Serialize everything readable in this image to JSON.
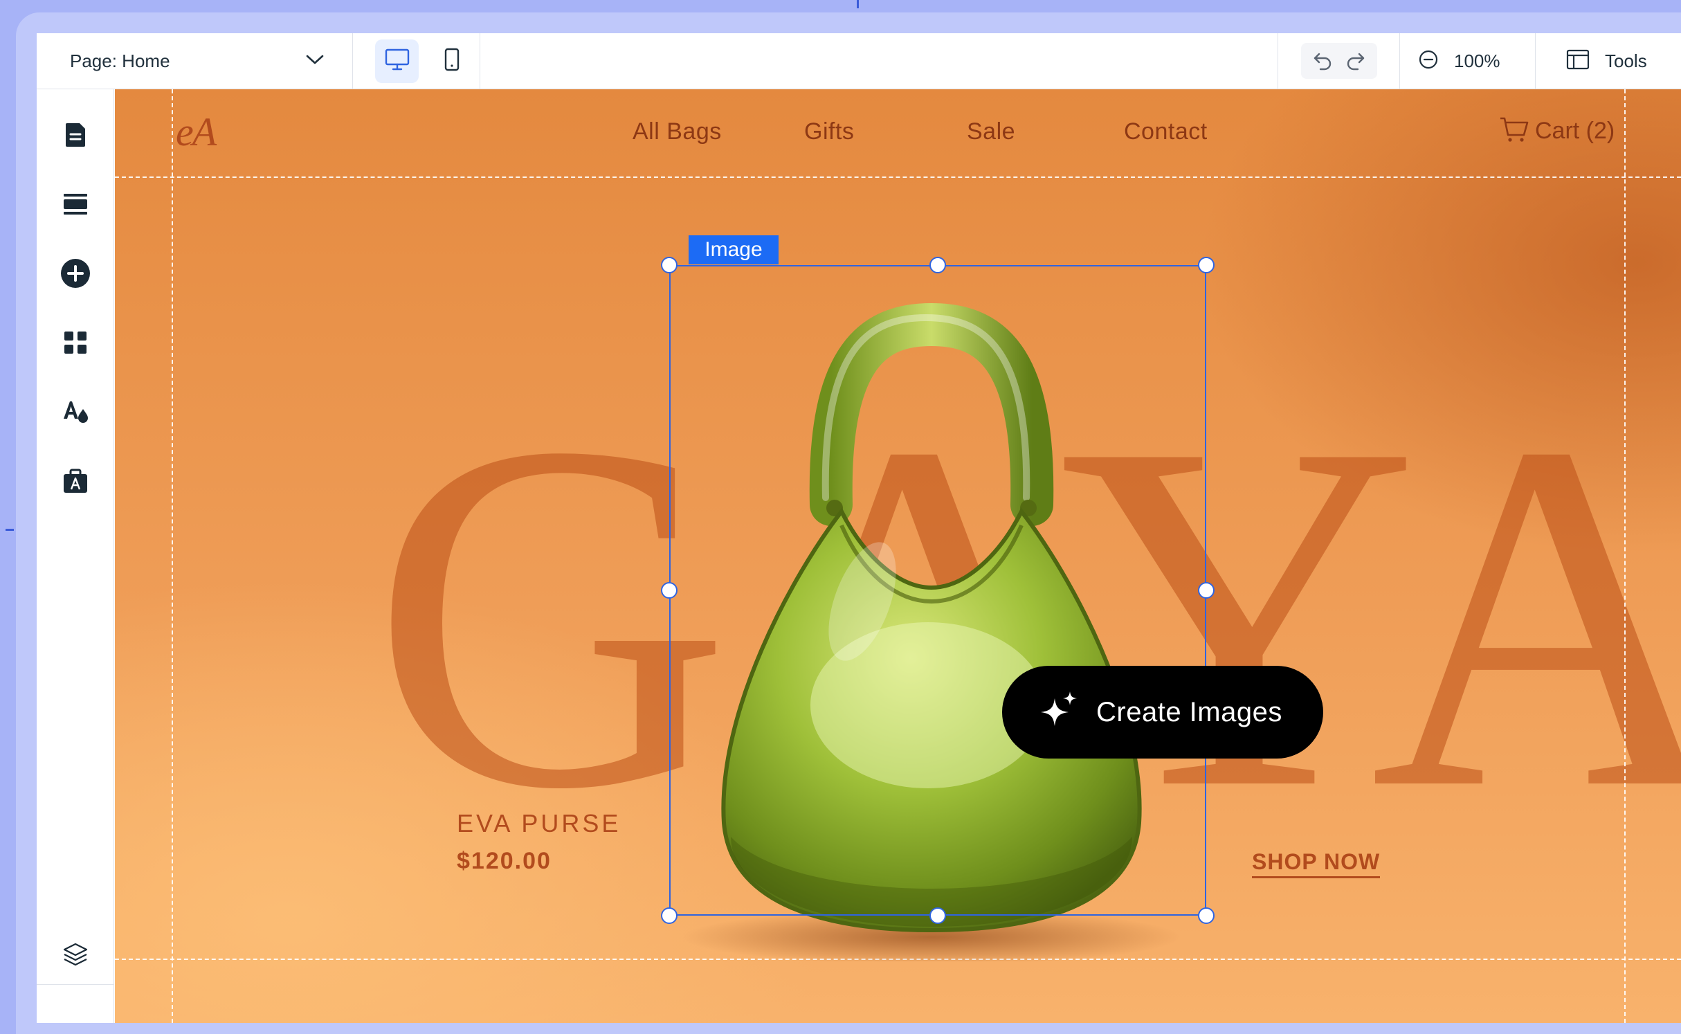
{
  "toolbar": {
    "page_label": "Page: Home",
    "zoom": "100%",
    "tools_label": "Tools"
  },
  "site": {
    "logo": "eA",
    "nav": [
      "All Bags",
      "Gifts",
      "Sale",
      "Contact"
    ],
    "cart": "Cart (2)",
    "background_word": "GAYA",
    "product_name": "EVA PURSE",
    "product_price": "$120.00",
    "shop_now": "SHOP NOW"
  },
  "selection": {
    "label": "Image"
  },
  "create_images": {
    "label": "Create Images"
  },
  "colors": {
    "accent": "#1c6bf5",
    "brand_text": "#b24b1d",
    "canvas_orange": "#e4893f"
  }
}
